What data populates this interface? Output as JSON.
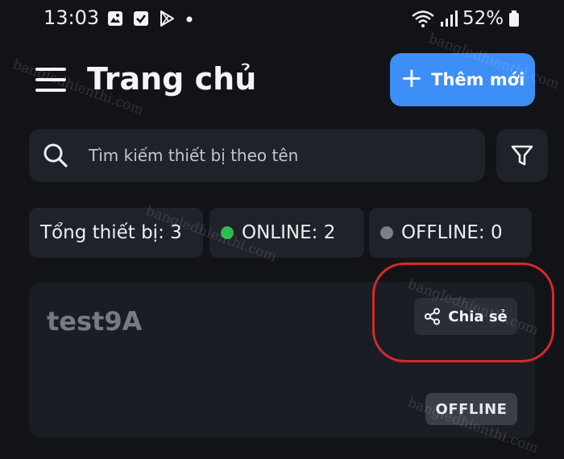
{
  "status_bar": {
    "time": "13:03",
    "battery": "52%",
    "icons_left": [
      "image-icon",
      "checkbox-icon",
      "play-store-icon",
      "dot-icon"
    ],
    "icons_right": [
      "wifi-icon",
      "signal-icon",
      "battery-icon"
    ]
  },
  "header": {
    "title": "Trang chủ",
    "add_button": "Thêm mới"
  },
  "search": {
    "placeholder": "Tìm kiếm thiết bị theo tên",
    "value": ""
  },
  "stats": {
    "total": "Tổng thiết bị: 3",
    "online": "ONLINE: 2",
    "offline": "OFFLINE: 0"
  },
  "device": {
    "name": "test9A",
    "share_label": "Chia sẻ",
    "status": "OFFLINE"
  },
  "watermark": "bangledhienthi.com",
  "colors": {
    "background": "#121317",
    "panel": "#1f2229",
    "accent": "#3e8ef7",
    "online": "#2dbb4e",
    "offline": "#7b7f88",
    "highlight": "#d32a2a"
  }
}
